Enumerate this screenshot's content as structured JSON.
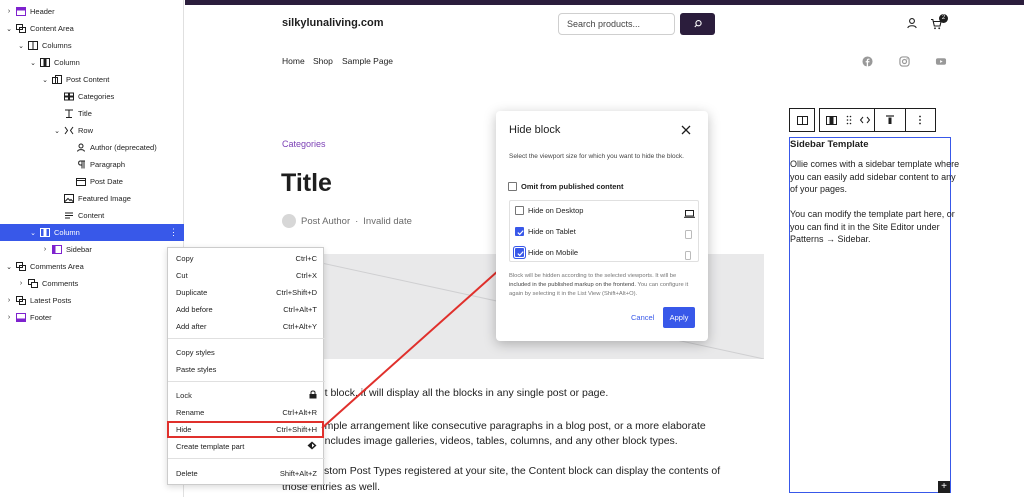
{
  "list_view": {
    "items": [
      {
        "label": "Header",
        "chevron": "›",
        "icon": "header-icon"
      },
      {
        "label": "Content Area",
        "chevron": "⌄",
        "icon": "group-icon"
      },
      {
        "label": "Columns",
        "chevron": "⌄",
        "icon": "columns-icon"
      },
      {
        "label": "Column",
        "chevron": "⌄",
        "icon": "column-icon"
      },
      {
        "label": "Post Content",
        "chevron": "⌄",
        "icon": "post-content-icon"
      },
      {
        "label": "Categories",
        "chevron": "",
        "icon": "categories-icon"
      },
      {
        "label": "Title",
        "chevron": "",
        "icon": "title-icon"
      },
      {
        "label": "Row",
        "chevron": "⌄",
        "icon": "row-icon"
      },
      {
        "label": "Author (deprecated)",
        "chevron": "",
        "icon": "author-icon"
      },
      {
        "label": "Paragraph",
        "chevron": "",
        "icon": "paragraph-icon"
      },
      {
        "label": "Post Date",
        "chevron": "",
        "icon": "post-date-icon"
      },
      {
        "label": "Featured Image",
        "chevron": "",
        "icon": "featured-image-icon"
      },
      {
        "label": "Content",
        "chevron": "",
        "icon": "content-icon"
      },
      {
        "label": "Column",
        "chevron": "⌄",
        "icon": "column-icon"
      },
      {
        "label": "Sidebar",
        "chevron": "›",
        "icon": "sidebar-icon"
      },
      {
        "label": "Comments Area",
        "chevron": "⌄",
        "icon": "group-icon"
      },
      {
        "label": "Comments",
        "chevron": "›",
        "icon": "comments-icon"
      },
      {
        "label": "Latest Posts",
        "chevron": "›",
        "icon": "group-icon"
      },
      {
        "label": "Footer",
        "chevron": "›",
        "icon": "footer-icon"
      }
    ],
    "more_options": "⋮"
  },
  "context_menu": {
    "items": [
      {
        "label": "Copy",
        "shortcut": "Ctrl+C"
      },
      {
        "label": "Cut",
        "shortcut": "Ctrl+X"
      },
      {
        "label": "Duplicate",
        "shortcut": "Ctrl+Shift+D"
      },
      {
        "label": "Add before",
        "shortcut": "Ctrl+Alt+T"
      },
      {
        "label": "Add after",
        "shortcut": "Ctrl+Alt+Y"
      },
      {
        "label": "Copy styles",
        "shortcut": ""
      },
      {
        "label": "Paste styles",
        "shortcut": ""
      },
      {
        "label": "Lock",
        "shortcut": ""
      },
      {
        "label": "Rename",
        "shortcut": "Ctrl+Alt+R"
      },
      {
        "label": "Hide",
        "shortcut": "Ctrl+Shift+H"
      },
      {
        "label": "Create template part",
        "shortcut": ""
      },
      {
        "label": "Delete",
        "shortcut": "Shift+Alt+Z"
      }
    ]
  },
  "site": {
    "title": "silkylunaliving.com",
    "search_placeholder": "Search products...",
    "cart_count": "2",
    "nav": [
      "Home",
      "Shop",
      "Sample Page"
    ]
  },
  "post": {
    "category": "Categories",
    "title": "Title",
    "author": "Post Author",
    "separator": "·",
    "date": "Invalid date",
    "paragraphs": [
      "e Content block, it will display all the blocks in any single post or page.",
      "nt be a simple arrangement like consecutive paragraphs in a blog post, or a more elaborate",
      "tion that includes image galleries, videos, tables, columns, and any other block types.",
      "e any Custom Post Types registered at your site, the Content block can display the contents of",
      "those entries as well."
    ]
  },
  "sidebar_template": {
    "title": "Sidebar Template",
    "p1": "Ollie comes with a sidebar template where you can easily add sidebar content to any of your pages.",
    "p2": "You can modify the template part here, or you can find it in the Site Editor under Patterns → Sidebar.",
    "add_button": "+"
  },
  "modal": {
    "title": "Hide block",
    "description": "Select the viewport size for which you want to hide the block.",
    "omit_label": "Omit from published content",
    "options": [
      {
        "label": "Hide on Desktop",
        "checked": false,
        "icon": "desktop-icon"
      },
      {
        "label": "Hide on Tablet",
        "checked": true,
        "icon": "tablet-icon"
      },
      {
        "label": "Hide on Mobile",
        "checked": true,
        "icon": "mobile-icon"
      }
    ],
    "note_start": "Block will be hidden according to the selected viewports. It will be ",
    "note_bold": "included in the published markup on the frontend.",
    "note_end": " You can configure it again by selecting it in the List View (Shift+Alt+O).",
    "cancel": "Cancel",
    "apply": "Apply"
  },
  "colors": {
    "accent": "#3858e9",
    "header_bar": "#2b1d3c",
    "category_link": "#7b3fb5",
    "annotation": "#e0302c"
  }
}
